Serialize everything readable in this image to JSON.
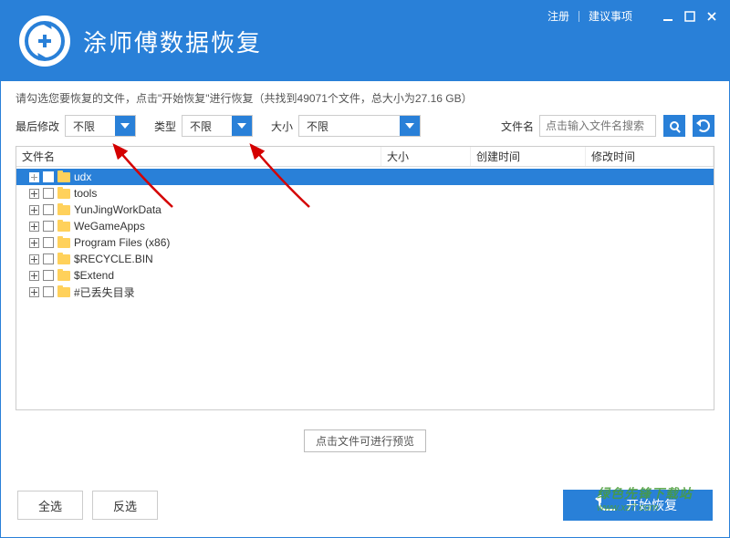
{
  "titlebar": {
    "register": "注册",
    "suggestions": "建议事项"
  },
  "app": {
    "title": "涂师傅数据恢复"
  },
  "instruction": "请勾选您要恢复的文件，点击\"开始恢复\"进行恢复（共找到49071个文件，总大小为27.16 GB）",
  "filters": {
    "last_modified_label": "最后修改",
    "last_modified_value": "不限",
    "type_label": "类型",
    "type_value": "不限",
    "size_label": "大小",
    "size_value": "不限",
    "filename_label": "文件名",
    "search_placeholder": "点击输入文件名搜索"
  },
  "table": {
    "col_name": "文件名",
    "col_size": "大小",
    "col_ctime": "创建时间",
    "col_mtime": "修改时间",
    "rows": [
      {
        "label": "udx",
        "selected": true
      },
      {
        "label": "tools",
        "selected": false
      },
      {
        "label": "YunJingWorkData",
        "selected": false
      },
      {
        "label": "WeGameApps",
        "selected": false
      },
      {
        "label": "Program Files (x86)",
        "selected": false
      },
      {
        "label": "$RECYCLE.BIN",
        "selected": false
      },
      {
        "label": "$Extend",
        "selected": false
      },
      {
        "label": "#已丢失目录",
        "selected": false
      }
    ]
  },
  "preview_hint": "点击文件可进行预览",
  "buttons": {
    "select_all": "全选",
    "invert_selection": "反选",
    "start_recovery": "开始恢复"
  },
  "watermark": {
    "line1": "绿色先锋下载站",
    "line2": "www.xz7.com"
  }
}
